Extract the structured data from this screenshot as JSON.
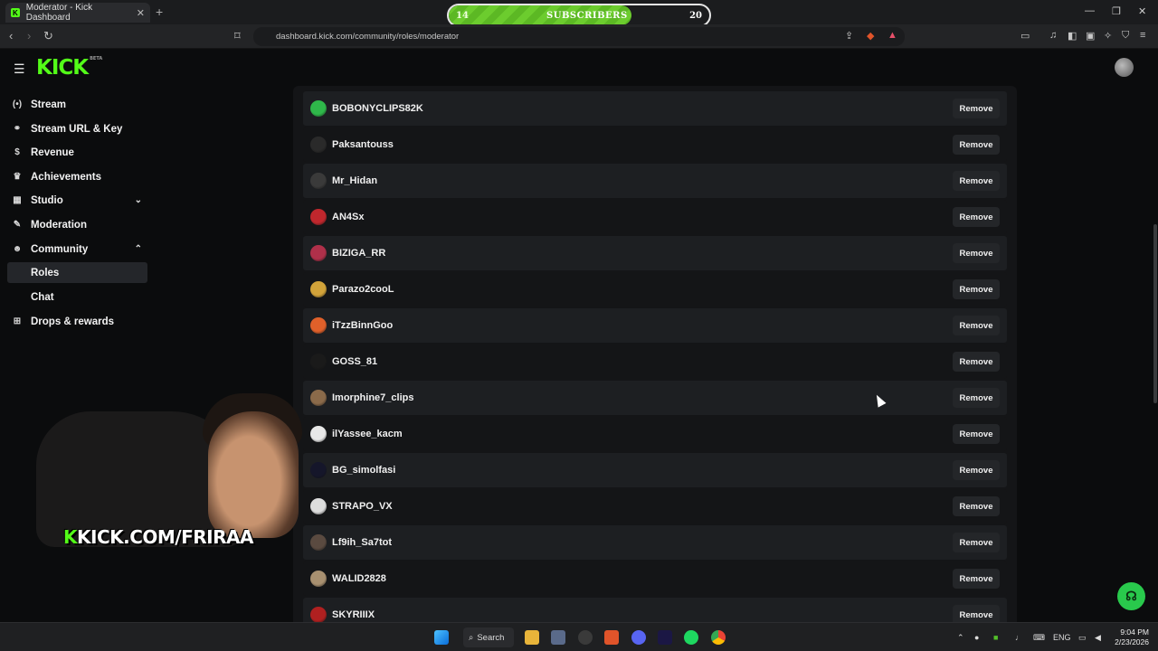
{
  "browser": {
    "tab_title": "Moderator - Kick Dashboard",
    "tab_favicon": "K",
    "url": "dashboard.kick.com/community/roles/moderator"
  },
  "subscribers_widget": {
    "current": "14",
    "label": "SUBSCRIBERS",
    "goal": "20",
    "progress_fraction": 0.7
  },
  "header": {
    "logo_text": "KICK",
    "logo_badge": "BETA"
  },
  "sidebar": {
    "items": [
      {
        "label": "Stream",
        "icon": "broadcast-icon",
        "glyph": "(•)"
      },
      {
        "label": "Stream URL & Key",
        "icon": "link-icon",
        "glyph": "⚭"
      },
      {
        "label": "Revenue",
        "icon": "dollar-icon",
        "glyph": "$"
      },
      {
        "label": "Achievements",
        "icon": "trophy-icon",
        "glyph": "♛"
      },
      {
        "label": "Studio",
        "icon": "layout-icon",
        "glyph": "▦"
      },
      {
        "label": "Moderation",
        "icon": "wrench-icon",
        "glyph": "✎"
      },
      {
        "label": "Community",
        "icon": "people-icon",
        "glyph": "☻"
      },
      {
        "label": "Roles"
      },
      {
        "label": "Chat"
      },
      {
        "label": "Drops & rewards",
        "icon": "gift-icon",
        "glyph": "⊞"
      }
    ]
  },
  "moderators": {
    "remove_label": "Remove",
    "rows": [
      {
        "name": "BOBONYCLIPS82K",
        "color": "#2fb84a"
      },
      {
        "name": "Paksantouss",
        "color": "#2a2a2a"
      },
      {
        "name": "Mr_Hidan",
        "color": "#3a3a3a"
      },
      {
        "name": "AN4Sx",
        "color": "#c0272d"
      },
      {
        "name": "BIZIGA_RR",
        "color": "#b0304a"
      },
      {
        "name": "Parazo2cooL",
        "color": "#d2a33a"
      },
      {
        "name": "iTzzBinnGoo",
        "color": "#e0602a"
      },
      {
        "name": "GOSS_81",
        "color": "#1a1a1a"
      },
      {
        "name": "Imorphine7_clips",
        "color": "#8a6a4a"
      },
      {
        "name": "ilYassee_kacm",
        "color": "#e8e8e8"
      },
      {
        "name": "BG_simolfasi",
        "color": "#15162a"
      },
      {
        "name": "STRAPO_VX",
        "color": "#dddddd"
      },
      {
        "name": "Lf9ih_Sa7tot",
        "color": "#5a4a40"
      },
      {
        "name": "WALID2828",
        "color": "#a89070"
      },
      {
        "name": "SKYRIIIX",
        "color": "#b02020"
      }
    ]
  },
  "overlay": {
    "k_glyph": "K",
    "text": "KICK.COM/FRIRAA"
  },
  "taskbar": {
    "search_label": "Search",
    "lang": "ENG",
    "time": "9:04 PM",
    "date": "2/23/2026"
  }
}
